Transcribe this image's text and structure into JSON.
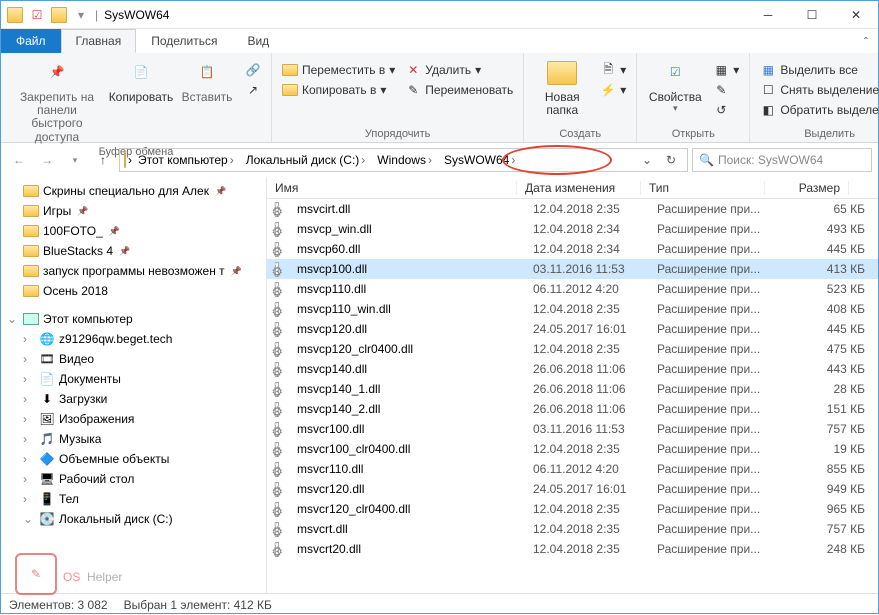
{
  "window": {
    "title": "SysWOW64"
  },
  "tabs": {
    "file": "Файл",
    "home": "Главная",
    "share": "Поделиться",
    "view": "Вид"
  },
  "ribbon": {
    "clipboard": {
      "pin": "Закрепить на панели\nбыстрого доступа",
      "copy": "Копировать",
      "paste": "Вставить",
      "label": "Буфер обмена"
    },
    "organize": {
      "move": "Переместить в",
      "copyto": "Копировать в",
      "delete": "Удалить",
      "rename": "Переименовать",
      "label": "Упорядочить"
    },
    "new": {
      "folder": "Новая\nпапка",
      "label": "Создать"
    },
    "open": {
      "props": "Свойства",
      "label": "Открыть"
    },
    "select": {
      "all": "Выделить все",
      "none": "Снять выделение",
      "invert": "Обратить выделение",
      "label": "Выделить"
    }
  },
  "breadcrumbs": [
    "Этот компьютер",
    "Локальный диск (C:)",
    "Windows",
    "SysWOW64"
  ],
  "search": {
    "placeholder": "Поиск: SysWOW64"
  },
  "tree": {
    "quick": [
      {
        "label": "Скрины специально для Алек",
        "pin": true
      },
      {
        "label": "Игры",
        "pin": true
      },
      {
        "label": "100FOTO_",
        "pin": true
      },
      {
        "label": "BlueStacks 4",
        "pin": true
      },
      {
        "label": "запуск программы невозможен т",
        "pin": true
      },
      {
        "label": "Осень 2018"
      }
    ],
    "thispc": "Этот компьютер",
    "pcitems": [
      "z91296qw.beget.tech",
      "Видео",
      "Документы",
      "Загрузки",
      "Изображения",
      "Музыка",
      "Объемные объекты",
      "Рабочий стол",
      "Тел"
    ],
    "localdisk": "Локальный диск (C:)"
  },
  "columns": {
    "name": "Имя",
    "date": "Дата изменения",
    "type": "Тип",
    "size": "Размер"
  },
  "filetype": "Расширение при...",
  "files": [
    {
      "name": "msvcirt.dll",
      "date": "12.04.2018 2:35",
      "size": "65 КБ"
    },
    {
      "name": "msvcp_win.dll",
      "date": "12.04.2018 2:34",
      "size": "493 КБ"
    },
    {
      "name": "msvcp60.dll",
      "date": "12.04.2018 2:34",
      "size": "445 КБ"
    },
    {
      "name": "msvcp100.dll",
      "date": "03.11.2016 11:53",
      "size": "413 КБ",
      "selected": true
    },
    {
      "name": "msvcp110.dll",
      "date": "06.11.2012 4:20",
      "size": "523 КБ"
    },
    {
      "name": "msvcp110_win.dll",
      "date": "12.04.2018 2:35",
      "size": "408 КБ"
    },
    {
      "name": "msvcp120.dll",
      "date": "24.05.2017 16:01",
      "size": "445 КБ"
    },
    {
      "name": "msvcp120_clr0400.dll",
      "date": "12.04.2018 2:35",
      "size": "475 КБ"
    },
    {
      "name": "msvcp140.dll",
      "date": "26.06.2018 11:06",
      "size": "443 КБ"
    },
    {
      "name": "msvcp140_1.dll",
      "date": "26.06.2018 11:06",
      "size": "28 КБ"
    },
    {
      "name": "msvcp140_2.dll",
      "date": "26.06.2018 11:06",
      "size": "151 КБ"
    },
    {
      "name": "msvcr100.dll",
      "date": "03.11.2016 11:53",
      "size": "757 КБ"
    },
    {
      "name": "msvcr100_clr0400.dll",
      "date": "12.04.2018 2:35",
      "size": "19 КБ"
    },
    {
      "name": "msvcr110.dll",
      "date": "06.11.2012 4:20",
      "size": "855 КБ"
    },
    {
      "name": "msvcr120.dll",
      "date": "24.05.2017 16:01",
      "size": "949 КБ"
    },
    {
      "name": "msvcr120_clr0400.dll",
      "date": "12.04.2018 2:35",
      "size": "965 КБ"
    },
    {
      "name": "msvcrt.dll",
      "date": "12.04.2018 2:35",
      "size": "757 КБ"
    },
    {
      "name": "msvcrt20.dll",
      "date": "12.04.2018 2:35",
      "size": "248 КБ"
    }
  ],
  "status": {
    "count": "Элементов: 3 082",
    "selection": "Выбран 1 элемент: 412 КБ"
  },
  "watermark": {
    "os": "OS",
    "helper": "Helper"
  }
}
